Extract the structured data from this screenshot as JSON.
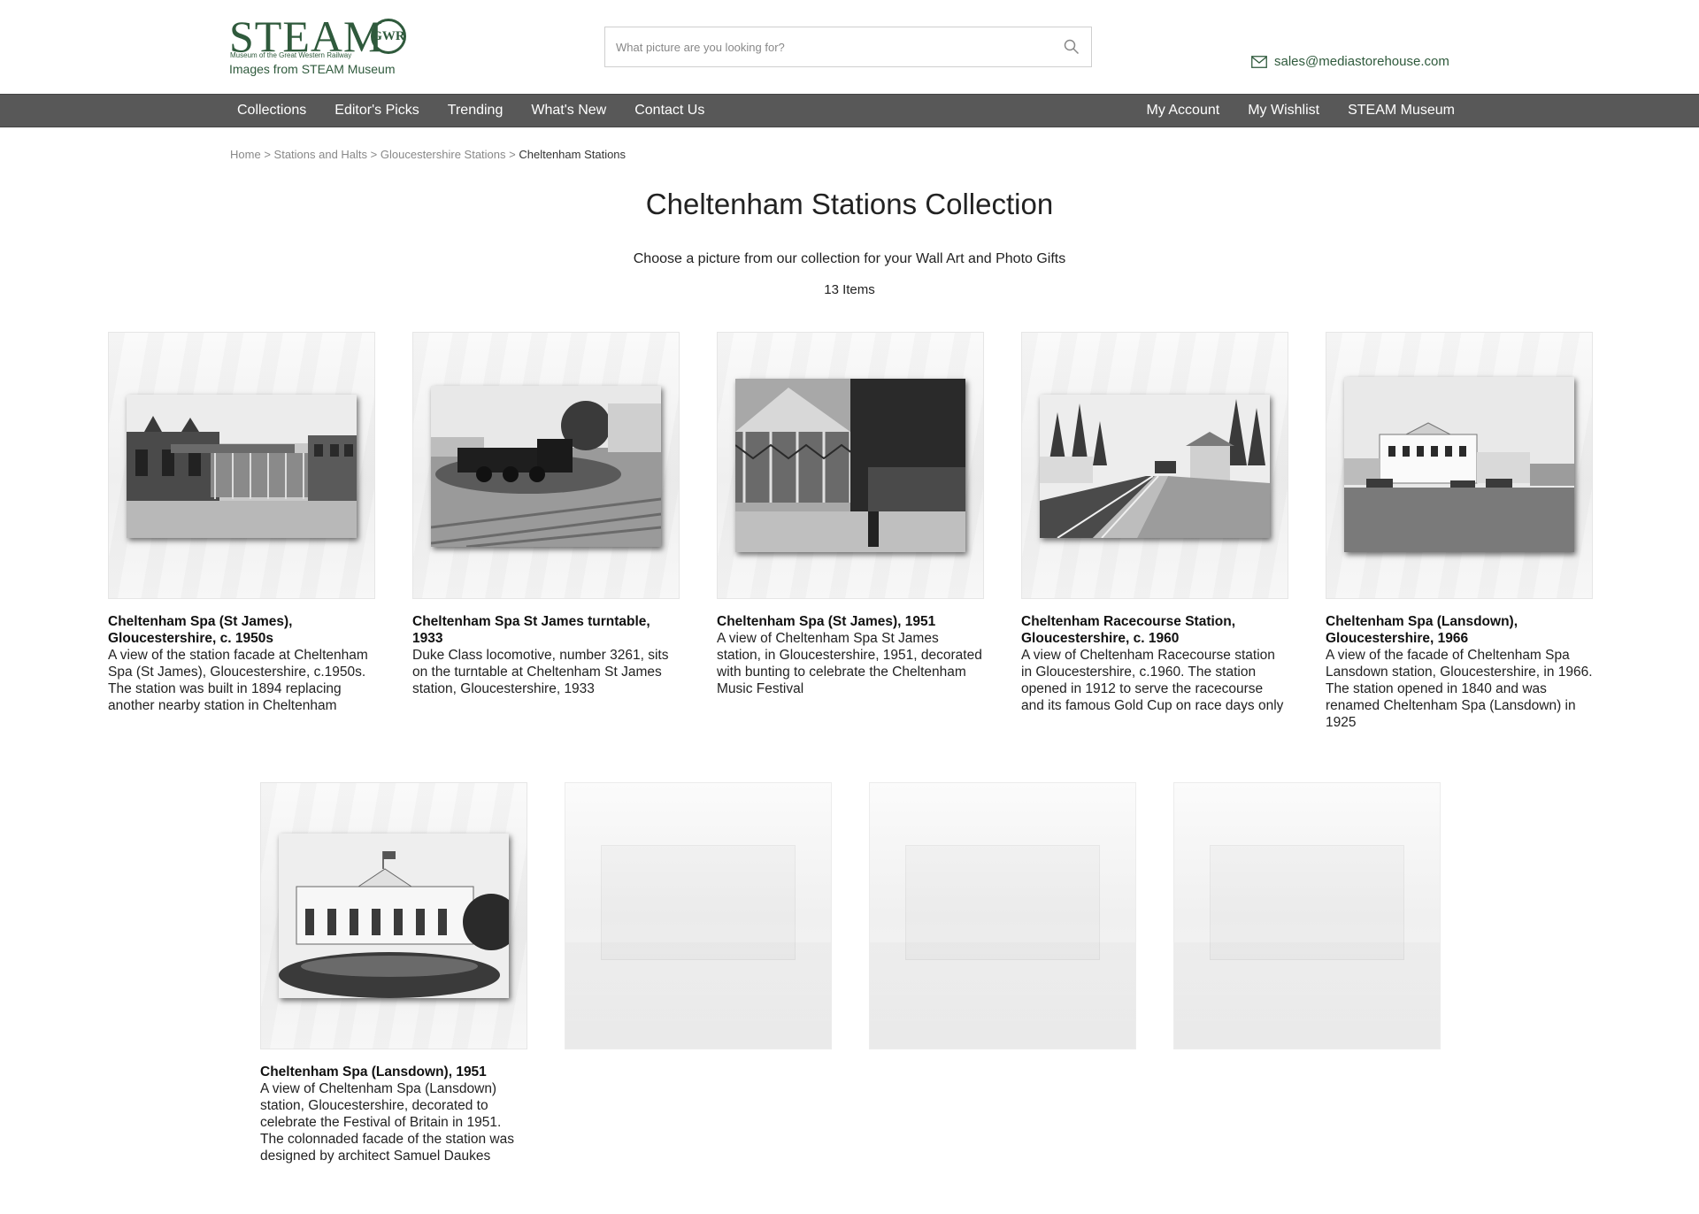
{
  "brand": {
    "logo_word": "STEAM",
    "logo_badge": "GWR",
    "logo_sub": "Museum of the Great Western Railway",
    "tagline": "Images from STEAM Museum",
    "green": "#2f5a3c"
  },
  "search": {
    "placeholder": "What picture are you looking for?",
    "icon": "search-icon"
  },
  "contact": {
    "email": "sales@mediastorehouse.com",
    "icon": "mail-icon"
  },
  "nav": {
    "background": "#585858",
    "left": [
      "Collections",
      "Editor's Picks",
      "Trending",
      "What's New",
      "Contact Us"
    ],
    "right": [
      "My Account",
      "My Wishlist",
      "STEAM Museum"
    ]
  },
  "breadcrumb": {
    "items": [
      "Home",
      "Stations and Halts",
      "Gloucestershire Stations"
    ],
    "separator": ">",
    "current": "Cheltenham Stations"
  },
  "page": {
    "title": "Cheltenham Stations Collection",
    "subtitle": "Choose a picture from our collection for your Wall Art and Photo Gifts",
    "count": "13 Items"
  },
  "cards": [
    {
      "title": "Cheltenham Spa (St James), Gloucestershire, c. 1950s",
      "description": "A view of the station facade at Cheltenham Spa (St James), Gloucestershire, c.1950s. The station was built in 1894 replacing another nearby station in Cheltenham"
    },
    {
      "title": "Cheltenham Spa St James turntable, 1933",
      "description": "Duke Class locomotive, number 3261, sits on the turntable at Cheltenham St James station, Gloucestershire, 1933"
    },
    {
      "title": "Cheltenham Spa (St James), 1951",
      "description": "A view of Cheltenham Spa St James station, in Gloucestershire, 1951, decorated with bunting to celebrate the Cheltenham Music Festival"
    },
    {
      "title": "Cheltenham Racecourse Station, Gloucestershire, c. 1960",
      "description": "A view of Cheltenham Racecourse station in Gloucestershire, c.1960. The station opened in 1912 to serve the racecourse and its famous Gold Cup on race days only"
    },
    {
      "title": "Cheltenham Spa (Lansdown), Gloucestershire, 1966",
      "description": "A view of the facade of Cheltenham Spa Lansdown station, Gloucestershire, in 1966. The station opened in 1840 and was renamed Cheltenham Spa (Lansdown) in 1925"
    },
    {
      "title": "Cheltenham Spa (Lansdown), 1951",
      "description": "A view of Cheltenham Spa (Lansdown) station, Gloucestershire, decorated to celebrate the Festival of Britain in 1951. The colonnaded facade of the station was designed by architect Samuel Daukes"
    }
  ]
}
